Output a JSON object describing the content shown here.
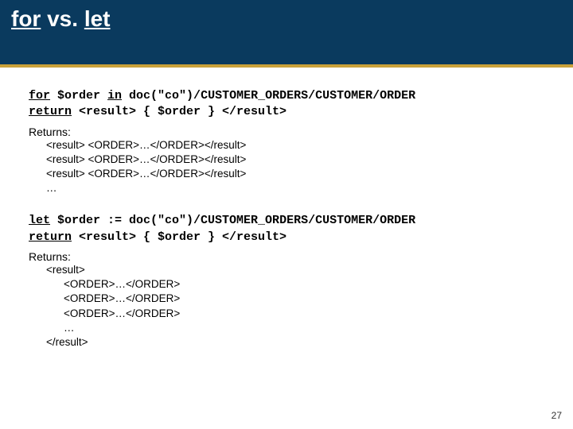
{
  "header": {
    "kw1": "for",
    "vs": " vs. ",
    "kw2": "let"
  },
  "for_block": {
    "line1_kw": "for",
    "line1_rest": " $order ",
    "line1_kw2": "in",
    "line1_rest2": " doc(\"co\")/CUSTOMER_ORDERS/CUSTOMER/ORDER",
    "line2_kw": "return",
    "line2_rest": " <result> { $order } </result>"
  },
  "for_returns_label": "Returns:",
  "for_results": {
    "l1": "<result> <ORDER>…</ORDER></result>",
    "l2": "<result> <ORDER>…</ORDER></result>",
    "l3": "<result> <ORDER>…</ORDER></result>",
    "l4": "…"
  },
  "let_block": {
    "line1_kw": "let",
    "line1_rest": " $order := doc(\"co\")/CUSTOMER_ORDERS/CUSTOMER/ORDER",
    "line2_kw": "return",
    "line2_rest": " <result> { $order } </result>"
  },
  "let_returns_label": "Returns:",
  "let_results": {
    "l1": "<result>",
    "l2": "<ORDER>…</ORDER>",
    "l3": "<ORDER>…</ORDER>",
    "l4": "<ORDER>…</ORDER>",
    "l5": "…",
    "l6": "</result>"
  },
  "page_number": "27"
}
